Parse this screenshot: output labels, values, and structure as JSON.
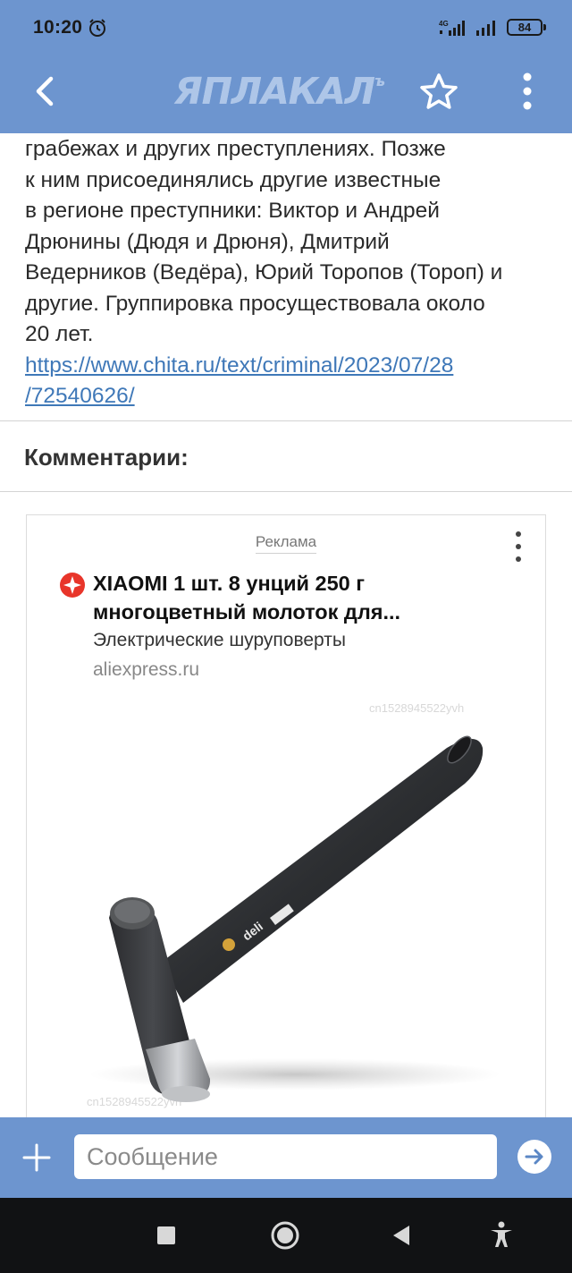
{
  "status_bar": {
    "time": "10:20",
    "network": "4G",
    "battery": "84"
  },
  "app_bar": {
    "logo_text": "ЯПЛАКАЛ",
    "logo_sup": "ъ",
    "accent_color": "#6d95cf"
  },
  "article": {
    "text": "грабежах и других преступлениях. Позже\nк ним присоединялись другие известные\nв регионе преступники: Виктор и Андрей\nДрюнины (Дюдя и Дрюня), Дмитрий\nВедерников (Ведёра), Юрий Торопов (Тороп) и\nдругие. Группировка просуществовала около\n20 лет.",
    "link": "https://www.chita.ru/text/criminal/2023/07/28\n/72540626/"
  },
  "comments": {
    "title": "Комментарии:"
  },
  "ad": {
    "label": "Реклама",
    "title": "XIAOMI 1 шт. 8 унций 250 г\nмногоцветный молоток для...",
    "subtitle": "Электрические шуруповерты",
    "domain": "aliexpress.ru",
    "watermark": "cn1528945522yvh",
    "product_brand": "deli",
    "product_badge": "home"
  },
  "composer": {
    "placeholder": "Сообщение"
  },
  "icons": {
    "back": "back-arrow-icon",
    "favorite": "star-icon",
    "menu": "more-vertical-icon",
    "add": "plus-icon",
    "send": "send-arrow-icon",
    "nav_recents": "square-icon",
    "nav_home": "circle-icon",
    "nav_back": "triangle-back-icon",
    "nav_accessibility": "accessibility-icon"
  }
}
